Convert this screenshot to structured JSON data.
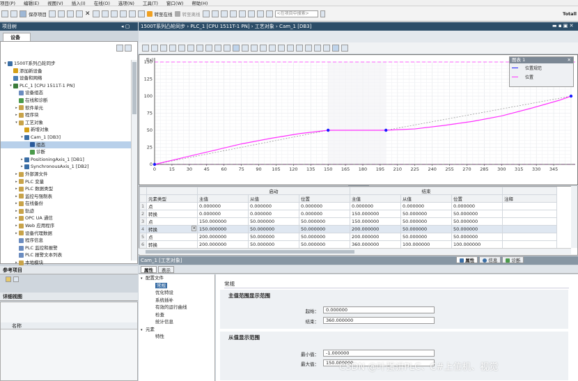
{
  "menu": [
    "项目(P)",
    "编辑(E)",
    "视图(V)",
    "插入(I)",
    "在线(O)",
    "选项(N)",
    "工具(T)",
    "窗口(W)",
    "帮助(H)"
  ],
  "toolbar": {
    "save_label": "保存项目",
    "go_online": "转至在线",
    "go_offline": "转至离线",
    "search_placeholder": "<在项目中搜索>",
    "brand": "Totall"
  },
  "left": {
    "title": "项目树",
    "tab": "设备",
    "tree": [
      {
        "label": "1500T系列凸轮同步",
        "level": 0,
        "exp": "▾",
        "icon": "#3a6ea5"
      },
      {
        "label": "添加新设备",
        "level": 1,
        "exp": "",
        "icon": "#d4a017"
      },
      {
        "label": "设备和网络",
        "level": 1,
        "exp": "",
        "icon": "#4a7fb5"
      },
      {
        "label": "PLC_1 [CPU 1511T-1 PN]",
        "level": 1,
        "exp": "▾",
        "icon": "#3b7c3b"
      },
      {
        "label": "设备组态",
        "level": 2,
        "exp": "",
        "icon": "#6b8cc0"
      },
      {
        "label": "在线和诊断",
        "level": 2,
        "exp": "",
        "icon": "#4a9a4a"
      },
      {
        "label": "软件单元",
        "level": 2,
        "exp": "▸",
        "icon": "#c8a34a"
      },
      {
        "label": "程序块",
        "level": 2,
        "exp": "▸",
        "icon": "#c8a34a"
      },
      {
        "label": "工艺对象",
        "level": 2,
        "exp": "▾",
        "icon": "#c8a34a"
      },
      {
        "label": "新增对象",
        "level": 3,
        "exp": "",
        "icon": "#d4a017"
      },
      {
        "label": "Cam_1 [DB3]",
        "level": 3,
        "exp": "▾",
        "icon": "#3a6ea5"
      },
      {
        "label": "组态",
        "level": 4,
        "exp": "",
        "icon": "#2a5a9a",
        "sel": true
      },
      {
        "label": "诊断",
        "level": 4,
        "exp": "",
        "icon": "#4a9a4a"
      },
      {
        "label": "PositioningAxis_1 [DB1]",
        "level": 3,
        "exp": "▸",
        "icon": "#3a6ea5"
      },
      {
        "label": "SynchronousAxis_1 [DB2]",
        "level": 3,
        "exp": "▸",
        "icon": "#3a6ea5"
      },
      {
        "label": "外部源文件",
        "level": 2,
        "exp": "▸",
        "icon": "#c8a34a"
      },
      {
        "label": "PLC 变量",
        "level": 2,
        "exp": "▸",
        "icon": "#c8a34a"
      },
      {
        "label": "PLC 数据类型",
        "level": 2,
        "exp": "▸",
        "icon": "#c8a34a"
      },
      {
        "label": "监控与强制表",
        "level": 2,
        "exp": "▸",
        "icon": "#c8a34a"
      },
      {
        "label": "在线备份",
        "level": 2,
        "exp": "▸",
        "icon": "#c8a34a"
      },
      {
        "label": "轨迹",
        "level": 2,
        "exp": "▸",
        "icon": "#c8a34a"
      },
      {
        "label": "OPC UA 通信",
        "level": 2,
        "exp": "▸",
        "icon": "#c8a34a"
      },
      {
        "label": "Web 应用程序",
        "level": 2,
        "exp": "▸",
        "icon": "#c8a34a"
      },
      {
        "label": "设备代理数据",
        "level": 2,
        "exp": "▸",
        "icon": "#c8a34a"
      },
      {
        "label": "程序信息",
        "level": 2,
        "exp": "",
        "icon": "#6b8cc0"
      },
      {
        "label": "PLC 监控和报警",
        "level": 2,
        "exp": "",
        "icon": "#6b8cc0"
      },
      {
        "label": "PLC 报警文本列表",
        "level": 2,
        "exp": "",
        "icon": "#6b8cc0"
      },
      {
        "label": "本地模块",
        "level": 2,
        "exp": "▸",
        "icon": "#c8a34a"
      }
    ],
    "ref": "参考项目",
    "detail": "详细视图",
    "detail_col": "名称"
  },
  "editor": {
    "title": "1500T系列凸轮同步 › PLC_1 [CPU 1511T-1 PN] › 工艺对象 › Cam_1 [DB3]"
  },
  "chart_data": {
    "type": "line",
    "ylabel": "f(x)",
    "xlim": [
      0,
      360
    ],
    "ylim": [
      0,
      150
    ],
    "xticks": [
      0,
      15,
      30,
      45,
      60,
      75,
      90,
      105,
      120,
      135,
      150,
      165,
      180,
      195,
      210,
      225,
      240,
      255,
      270,
      285,
      300,
      315,
      330,
      345
    ],
    "yticks": [
      0,
      25,
      50,
      75,
      100,
      125,
      150
    ],
    "legend_title": "图表 1",
    "series": [
      {
        "name": "位置规范",
        "color": "#1a1aff",
        "x": [
          0,
          150,
          200,
          360
        ],
        "values": [
          0,
          50,
          50,
          100
        ]
      },
      {
        "name": "位置",
        "color": "#ff30ff",
        "x": [
          0,
          25,
          50,
          75,
          100,
          125,
          150,
          200,
          225,
          250,
          275,
          300,
          325,
          350,
          360
        ],
        "values": [
          0,
          10,
          20,
          30,
          38,
          45,
          50,
          50,
          52,
          57,
          63,
          71,
          82,
          94,
          100
        ]
      }
    ],
    "points": [
      {
        "x": 0,
        "y": 0
      },
      {
        "x": 150,
        "y": 50
      },
      {
        "x": 200,
        "y": 50
      },
      {
        "x": 360,
        "y": 100
      }
    ],
    "hlines": [
      150,
      0
    ],
    "grid": true
  },
  "grid": {
    "group_start": "启动",
    "group_end": "结束",
    "cols": [
      "元素类型",
      "主值",
      "从值",
      "位置",
      "主值",
      "从值",
      "位置",
      "注释"
    ],
    "rows": [
      [
        "1",
        "点",
        "0.000000",
        "0.000000",
        "0.000000",
        "0.000000",
        "0.000000",
        "0.000000",
        ""
      ],
      [
        "2",
        "转换",
        "0.000000",
        "0.000000",
        "0.000000",
        "150.000000",
        "50.000000",
        "50.000000",
        ""
      ],
      [
        "3",
        "点",
        "150.000000",
        "50.000000",
        "50.000000",
        "150.000000",
        "50.000000",
        "50.000000",
        ""
      ],
      [
        "4",
        "转换",
        "150.000000",
        "50.000000",
        "50.000000",
        "200.000000",
        "50.000000",
        "50.000000",
        ""
      ],
      [
        "5",
        "点",
        "200.000000",
        "50.000000",
        "50.000000",
        "200.000000",
        "50.000000",
        "50.000000",
        ""
      ],
      [
        "6",
        "转换",
        "200.000000",
        "50.000000",
        "50.000000",
        "360.000000",
        "100.000000",
        "100.000000",
        ""
      ]
    ]
  },
  "props": {
    "title": "Cam_1 [工艺对象]",
    "tabs": [
      "属性",
      "表示"
    ],
    "right_tabs": [
      "属性",
      "信息",
      "诊断"
    ],
    "nav": [
      {
        "label": "配置文件",
        "level": 0,
        "exp": "▾"
      },
      {
        "label": "常规",
        "level": 1,
        "exp": "",
        "sel": true
      },
      {
        "label": "优化特设",
        "level": 1,
        "exp": ""
      },
      {
        "label": "系统插补",
        "level": 1,
        "exp": ""
      },
      {
        "label": "有效的运行曲线",
        "level": 1,
        "exp": ""
      },
      {
        "label": "检查",
        "level": 1,
        "exp": ""
      },
      {
        "label": "统计信息",
        "level": 1,
        "exp": ""
      },
      {
        "label": "元素",
        "level": 0,
        "exp": "▾"
      },
      {
        "label": "特性",
        "level": 1,
        "exp": ""
      }
    ],
    "section": "常规",
    "master_range": "主值范围显示范围",
    "start_label": "起始：",
    "start_value": "0.000000",
    "end_label": "结束：",
    "end_value": "360.000000",
    "slave_range": "从值显示范围",
    "min_label": "最小值：",
    "min_value": "-1.000000",
    "max_label": "最大值：",
    "max_value": "150.000000"
  },
  "watermark": "CSDN @叶强讲PLC、C#上位机、视觉"
}
